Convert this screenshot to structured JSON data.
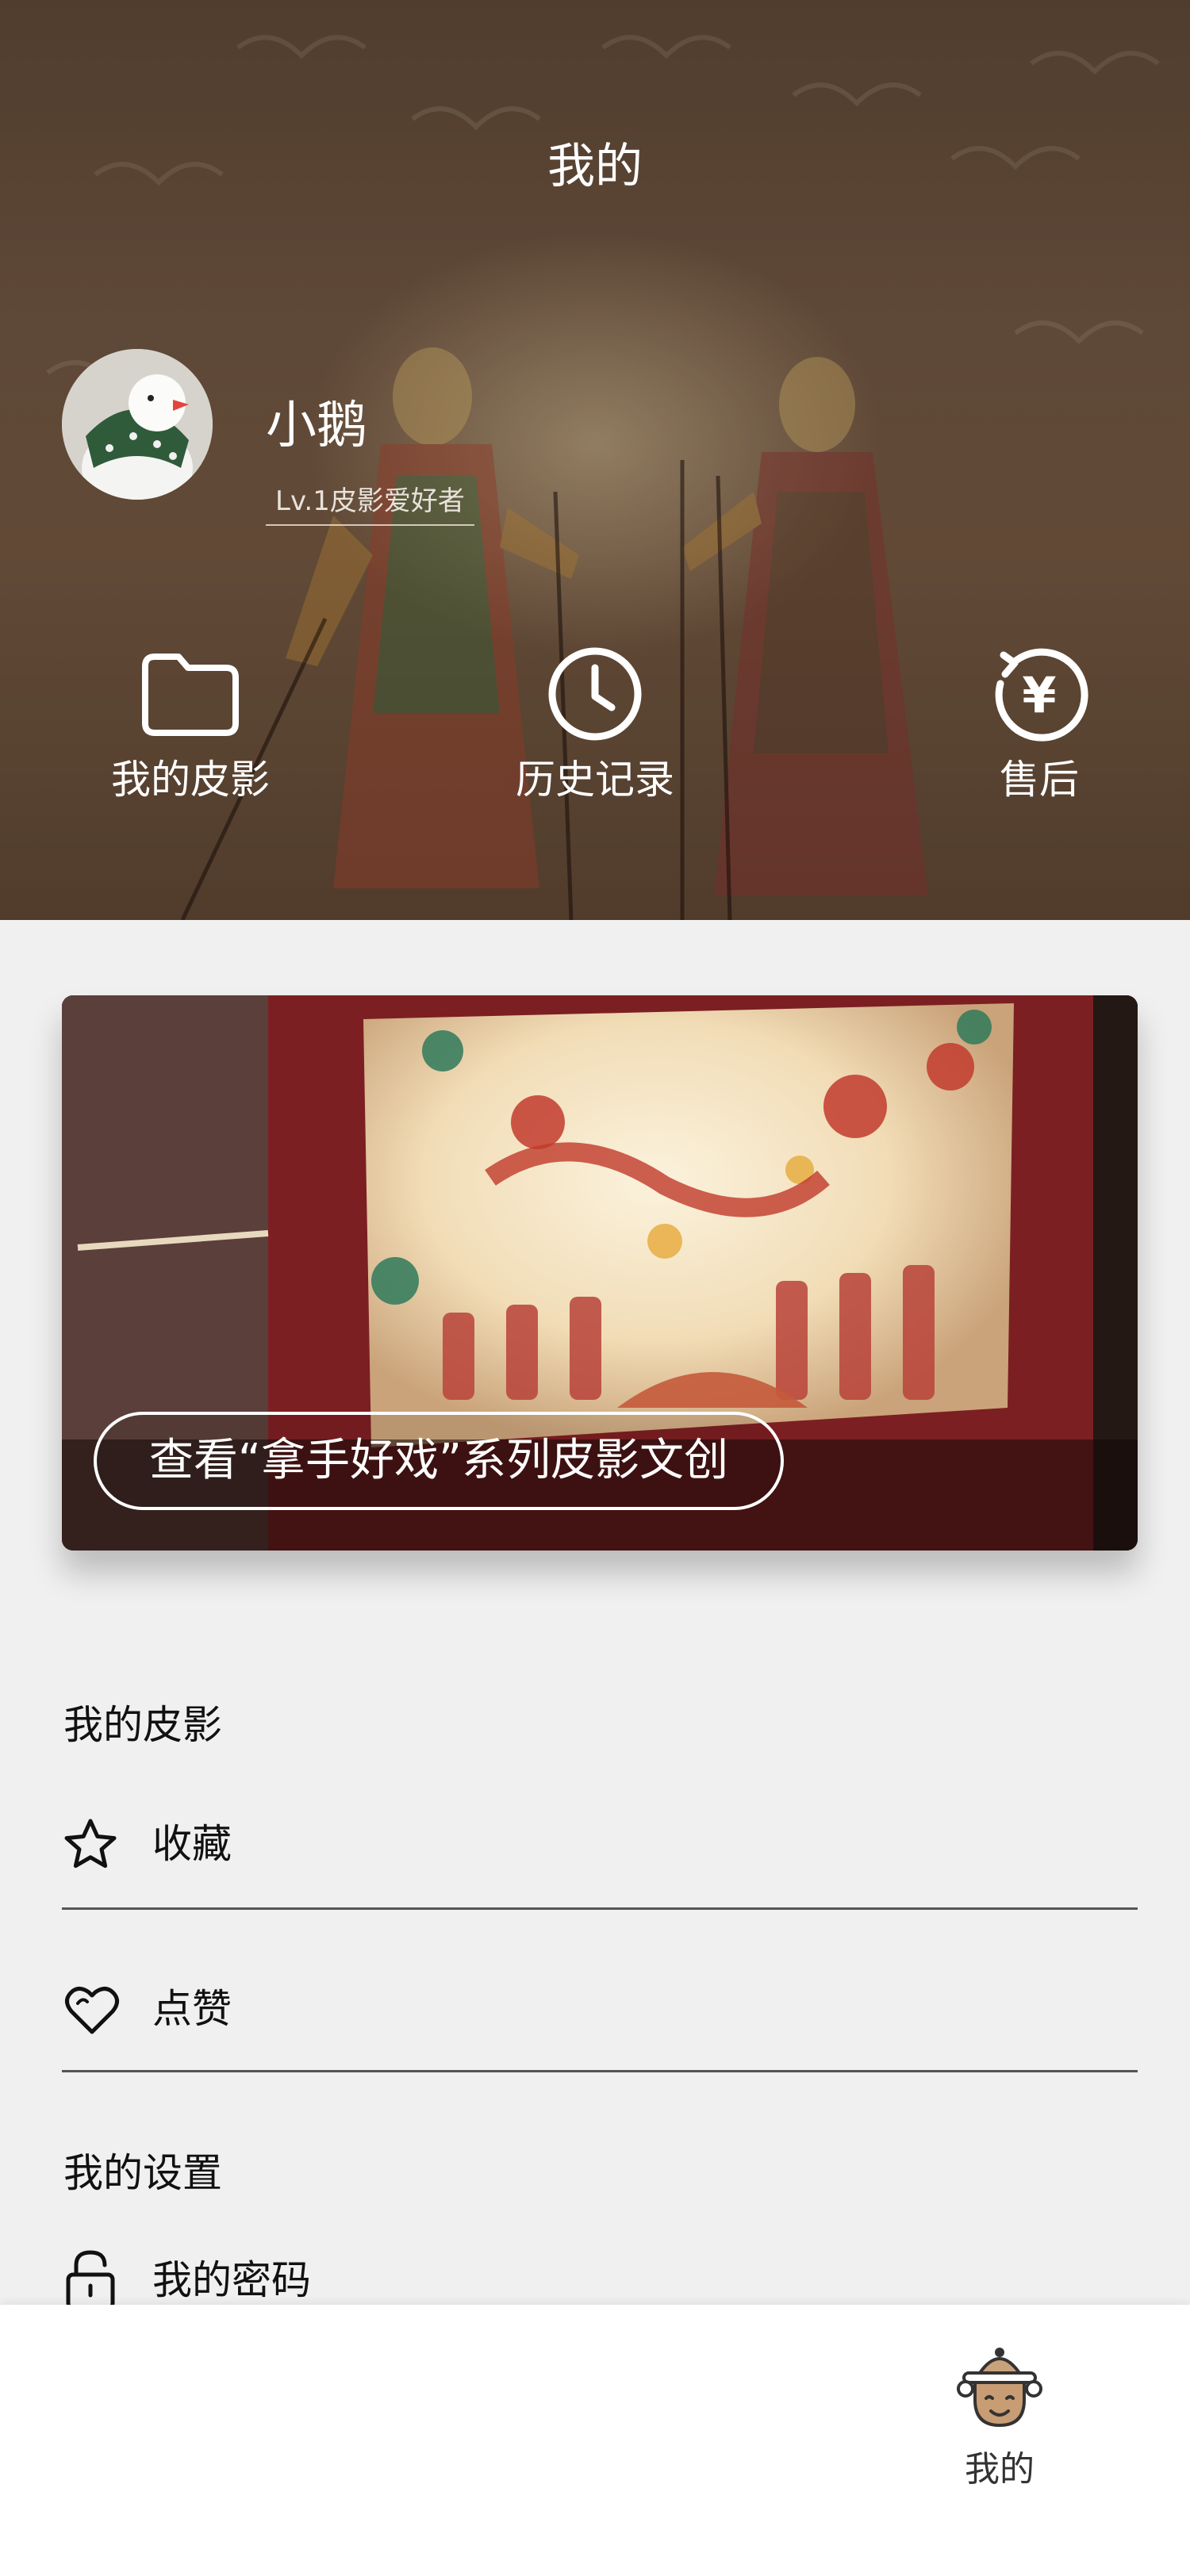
{
  "header": {
    "title": "我的",
    "user": {
      "name": "小鹅",
      "level": "Lv.1皮影爱好者"
    },
    "quick_actions": [
      {
        "label": "我的皮影",
        "icon": "folder-icon"
      },
      {
        "label": "历史记录",
        "icon": "clock-icon"
      },
      {
        "label": "售后",
        "icon": "refund-icon"
      }
    ]
  },
  "banner": {
    "button_label": "查看“拿手好戏”系列皮影文创"
  },
  "sections": {
    "my_shadow": {
      "title": "我的皮影",
      "items": [
        {
          "label": "收藏",
          "icon": "star-icon"
        },
        {
          "label": "点赞",
          "icon": "heart-icon"
        }
      ]
    },
    "settings": {
      "title": "我的设置",
      "items": [
        {
          "label": "我的密码",
          "icon": "lock-icon"
        }
      ]
    }
  },
  "tabbar": {
    "items": [
      {
        "label": "我的",
        "icon": "puppet-face-icon",
        "active": true
      }
    ]
  }
}
